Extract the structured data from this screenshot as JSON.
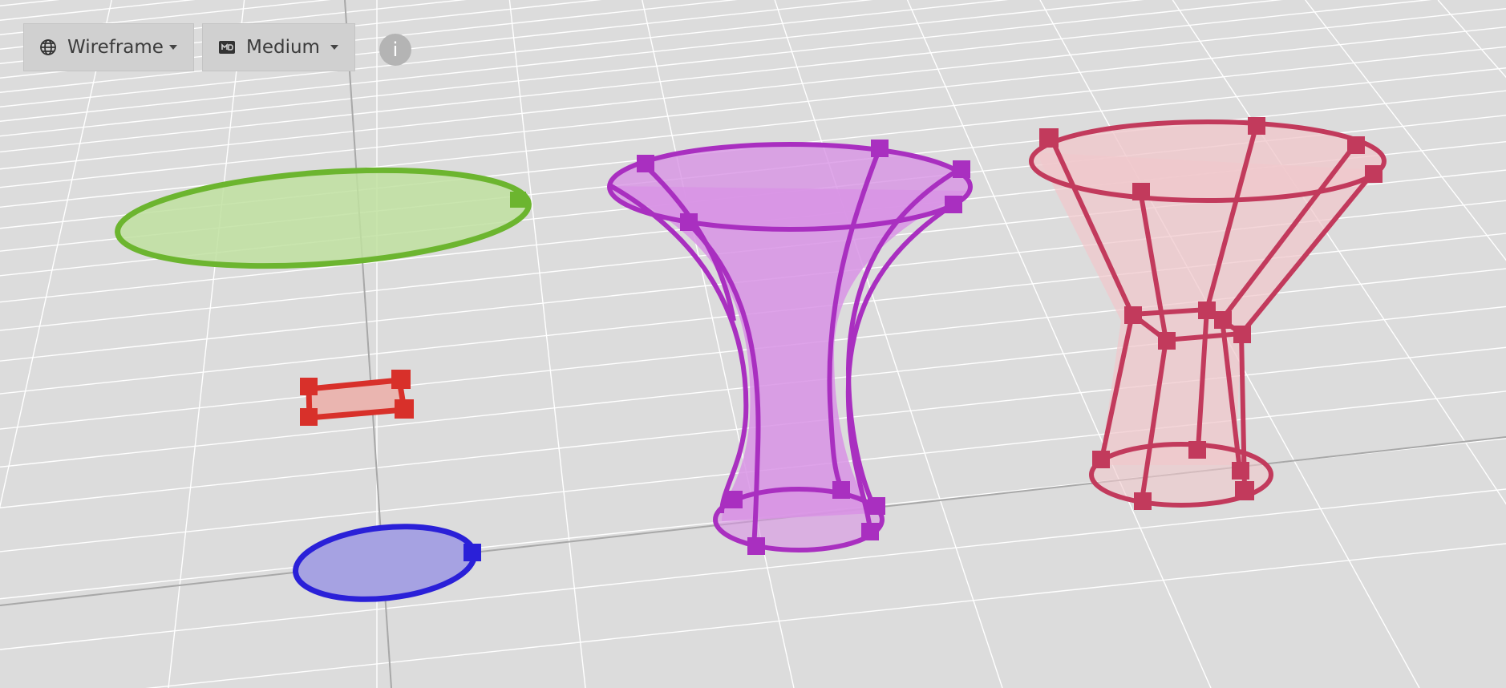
{
  "toolbar": {
    "render_mode": {
      "label": "Wireframe",
      "icon": "globe-icon"
    },
    "quality": {
      "label": "Medium",
      "icon": "quality-badge-icon"
    },
    "info": {
      "label": "i",
      "icon": "info-icon"
    }
  },
  "scene": {
    "background": "#dcdcdc",
    "grid_color": "#ffffff",
    "objects": [
      {
        "name": "green ellipse",
        "color": "#6cb52f",
        "fill": "#bfe0a0"
      },
      {
        "name": "red rectangle",
        "color": "#d8302a",
        "fill": "#eab5b0"
      },
      {
        "name": "blue ellipse",
        "color": "#2a20d8",
        "fill": "#a6a2e2"
      },
      {
        "name": "purple hyperboloid",
        "color": "#a92fc0",
        "fill": "#d893e5"
      },
      {
        "name": "pink frustum",
        "color": "#c23a5c",
        "fill": "#f0c8cc"
      }
    ]
  }
}
